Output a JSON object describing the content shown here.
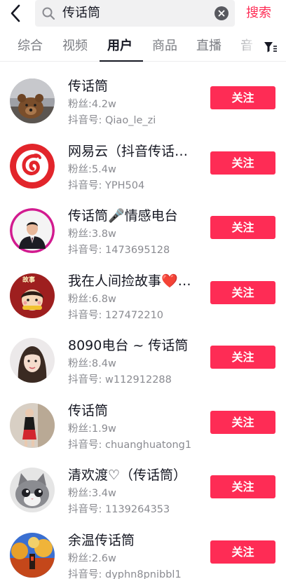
{
  "search": {
    "query": "传话筒",
    "submit_label": "搜索"
  },
  "tabs": [
    {
      "label": "综合"
    },
    {
      "label": "视频"
    },
    {
      "label": "用户"
    },
    {
      "label": "商品"
    },
    {
      "label": "直播"
    },
    {
      "label": "音"
    }
  ],
  "active_tab": "用户",
  "users": [
    {
      "name": "传话筒",
      "fans": "粉丝:4.2w",
      "douyin_id": "抖音号: Qiao_le_zi",
      "follow_label": "关注",
      "avatar_icon": "teddy-bear-icon"
    },
    {
      "name": "网易云（抖音传话…",
      "fans": "粉丝:5.4w",
      "douyin_id": "抖音号: YPH504",
      "follow_label": "关注",
      "avatar_icon": "netease-cloud-music-icon"
    },
    {
      "name": "传话筒🎤情感电台",
      "fans": "粉丝:3.8w",
      "douyin_id": "抖音号: 1473695128",
      "follow_label": "关注",
      "avatar_icon": "man-in-suit-icon"
    },
    {
      "name": "我在人间捡故事❤️…",
      "fans": "粉丝:6.8w",
      "douyin_id": "抖音号: 127472210",
      "follow_label": "关注",
      "avatar_icon": "cartoon-girl-icon",
      "avatar_caption": "故事"
    },
    {
      "name": "8090电台 ~ 传话筒",
      "fans": "粉丝:8.4w",
      "douyin_id": "抖音号: w112912288",
      "follow_label": "关注",
      "avatar_icon": "woman-portrait-icon"
    },
    {
      "name": "传话筒",
      "fans": "粉丝:1.9w",
      "douyin_id": "抖音号: chuanghuatong1",
      "follow_label": "关注",
      "avatar_icon": "woman-full-body-icon"
    },
    {
      "name": "清欢渡♡（传话筒）",
      "fans": "粉丝:3.4w",
      "douyin_id": "抖音号: 1139264353",
      "follow_label": "关注",
      "avatar_icon": "cat-icon"
    },
    {
      "name": "余温传话筒",
      "fans": "粉丝:2.6w",
      "douyin_id": "抖音号: dyphn8pnibbl1",
      "follow_label": "关注",
      "avatar_icon": "autumn-street-icon"
    }
  ],
  "colors": {
    "accent": "#fe2c55",
    "text_primary": "#161823",
    "text_secondary": "#8a8b91",
    "search_bg": "#f1f1f2"
  }
}
